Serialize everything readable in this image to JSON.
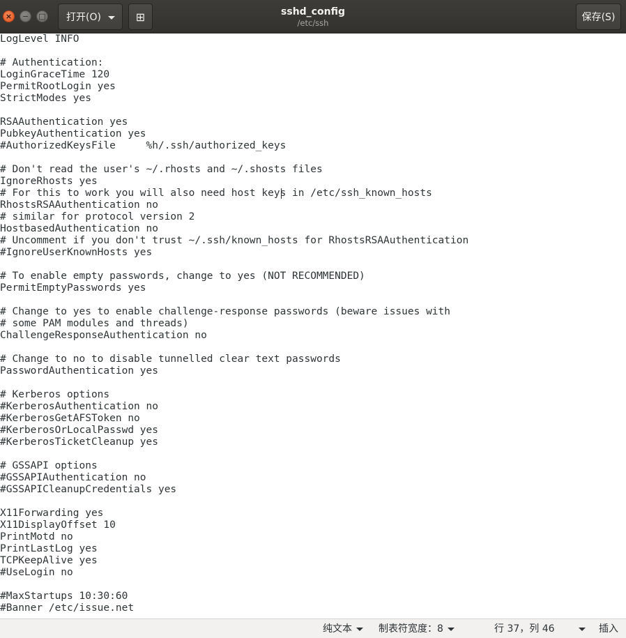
{
  "window": {
    "title": "sshd_config",
    "subtitle": "/etc/ssh"
  },
  "header": {
    "open_label": "打开(O)",
    "save_label": "保存(S)",
    "newtab_icon": "new-document-icon",
    "close_glyph": "×",
    "minimize_glyph": "−",
    "maximize_glyph": "□",
    "newtab_glyph": "⊞"
  },
  "editor": {
    "lines": [
      "LogLevel INFO",
      "",
      "# Authentication:",
      "LoginGraceTime 120",
      "PermitRootLogin yes",
      "StrictModes yes",
      "",
      "RSAAuthentication yes",
      "PubkeyAuthentication yes",
      "#AuthorizedKeysFile     %h/.ssh/authorized_keys",
      "",
      "# Don't read the user's ~/.rhosts and ~/.shosts files",
      "IgnoreRhosts yes",
      "# For this to work you will also need host keys in /etc/ssh_known_hosts",
      "RhostsRSAAuthentication no",
      "# similar for protocol version 2",
      "HostbasedAuthentication no",
      "# Uncomment if you don't trust ~/.ssh/known_hosts for RhostsRSAAuthentication",
      "#IgnoreUserKnownHosts yes",
      "",
      "# To enable empty passwords, change to yes (NOT RECOMMENDED)",
      "PermitEmptyPasswords yes",
      "",
      "# Change to yes to enable challenge-response passwords (beware issues with",
      "# some PAM modules and threads)",
      "ChallengeResponseAuthentication no",
      "",
      "# Change to no to disable tunnelled clear text passwords",
      "PasswordAuthentication yes",
      "",
      "# Kerberos options",
      "#KerberosAuthentication no",
      "#KerberosGetAFSToken no",
      "#KerberosOrLocalPasswd yes",
      "#KerberosTicketCleanup yes",
      "",
      "# GSSAPI options",
      "#GSSAPIAuthentication no",
      "#GSSAPICleanupCredentials yes",
      "",
      "X11Forwarding yes",
      "X11DisplayOffset 10",
      "PrintMotd no",
      "PrintLastLog yes",
      "TCPKeepAlive yes",
      "#UseLogin no",
      "",
      "#MaxStartups 10:30:60",
      "#Banner /etc/issue.net"
    ]
  },
  "statusbar": {
    "language": "纯文本",
    "tab_width": "制表符宽度：8",
    "position": "行 37，列 46",
    "mode": "插入"
  }
}
